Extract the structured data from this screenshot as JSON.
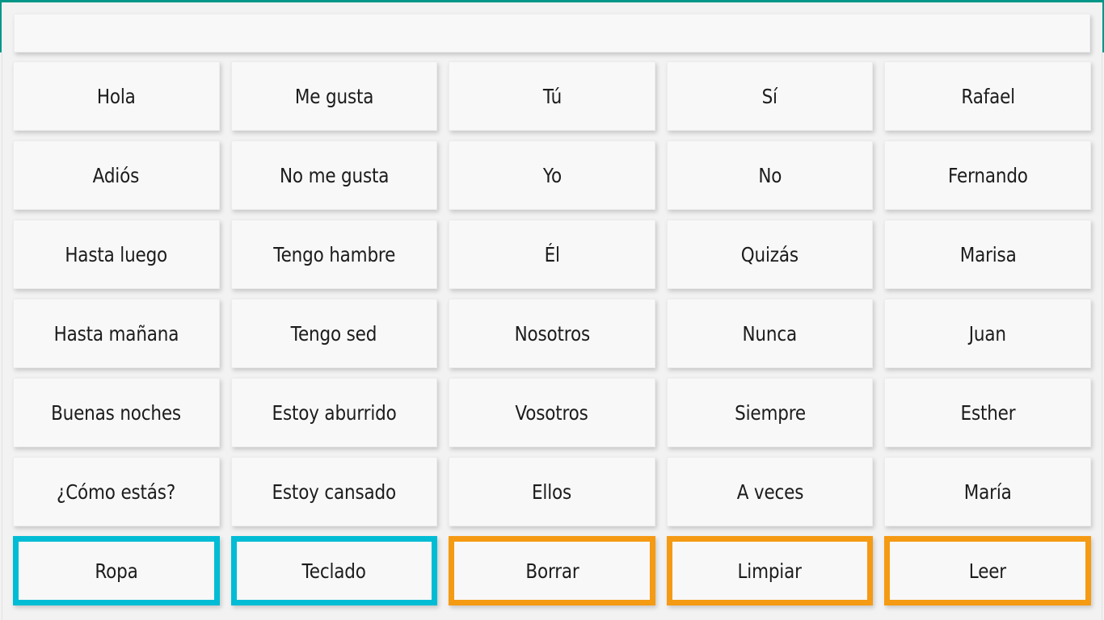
{
  "window": {
    "frame_color": "#009688",
    "background_color": "#f2f2f2"
  },
  "compose_bar": {
    "value": "",
    "placeholder": ""
  },
  "accents": {
    "cyan": "#00bcd4",
    "orange": "#f59a13",
    "teal": "#009688"
  },
  "board": {
    "columns": 5,
    "rows": 7,
    "cells": [
      {
        "label": "Hola",
        "style": "plain"
      },
      {
        "label": "Me gusta",
        "style": "plain"
      },
      {
        "label": "Tú",
        "style": "plain"
      },
      {
        "label": "Sí",
        "style": "plain"
      },
      {
        "label": "Rafael",
        "style": "plain"
      },
      {
        "label": "Adiós",
        "style": "plain"
      },
      {
        "label": "No me gusta",
        "style": "plain"
      },
      {
        "label": "Yo",
        "style": "plain"
      },
      {
        "label": "No",
        "style": "plain"
      },
      {
        "label": "Fernando",
        "style": "plain"
      },
      {
        "label": "Hasta luego",
        "style": "plain"
      },
      {
        "label": "Tengo hambre",
        "style": "plain"
      },
      {
        "label": "Él",
        "style": "plain"
      },
      {
        "label": "Quizás",
        "style": "plain"
      },
      {
        "label": "Marisa",
        "style": "plain"
      },
      {
        "label": "Hasta mañana",
        "style": "plain"
      },
      {
        "label": "Tengo sed",
        "style": "plain"
      },
      {
        "label": "Nosotros",
        "style": "plain"
      },
      {
        "label": "Nunca",
        "style": "plain"
      },
      {
        "label": "Juan",
        "style": "plain"
      },
      {
        "label": "Buenas noches",
        "style": "plain"
      },
      {
        "label": "Estoy aburrido",
        "style": "plain"
      },
      {
        "label": "Vosotros",
        "style": "plain"
      },
      {
        "label": "Siempre",
        "style": "plain"
      },
      {
        "label": "Esther",
        "style": "plain"
      },
      {
        "label": "¿Cómo estás?",
        "style": "plain"
      },
      {
        "label": "Estoy cansado",
        "style": "plain"
      },
      {
        "label": "Ellos",
        "style": "plain"
      },
      {
        "label": "A veces",
        "style": "plain"
      },
      {
        "label": "María",
        "style": "plain"
      },
      {
        "label": "Ropa",
        "style": "cyan"
      },
      {
        "label": "Teclado",
        "style": "cyan"
      },
      {
        "label": "Borrar",
        "style": "orange"
      },
      {
        "label": "Limpiar",
        "style": "orange"
      },
      {
        "label": "Leer",
        "style": "orange"
      }
    ]
  }
}
